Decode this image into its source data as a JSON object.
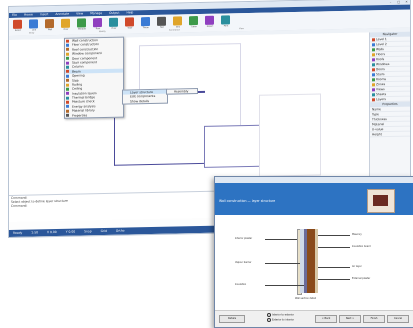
{
  "main_window": {
    "title": "",
    "menu": [
      "File",
      "Home",
      "Insert",
      "Annotate",
      "View",
      "Manage",
      "Output",
      "Help"
    ],
    "ribbon_buttons": [
      {
        "label": "Select",
        "color": "#d04a2b"
      },
      {
        "label": "Line",
        "color": "#3a7bd5"
      },
      {
        "label": "Wall",
        "color": "#b36a2c"
      },
      {
        "label": "Door",
        "color": "#e0a52a"
      },
      {
        "label": "Window",
        "color": "#3d9a4a"
      },
      {
        "label": "Roof",
        "color": "#8f3fbf"
      },
      {
        "label": "Floor",
        "color": "#2a8f9e"
      },
      {
        "label": "Stair",
        "color": "#d04a2b"
      },
      {
        "label": "Room",
        "color": "#3a7bd5"
      },
      {
        "label": "Text",
        "color": "#555555"
      },
      {
        "label": "Dim",
        "color": "#e0a52a"
      },
      {
        "label": "Layer",
        "color": "#3d9a4a"
      },
      {
        "label": "Export",
        "color": "#8f3fbf"
      },
      {
        "label": "Print",
        "color": "#2a8f9e"
      }
    ],
    "ribbon_groups": [
      "Draw",
      "Modify",
      "Annotation",
      "View"
    ],
    "menu_items": [
      {
        "label": "Wall construction",
        "color": "#d04a2b"
      },
      {
        "label": "Floor construction",
        "color": "#3a7bd5"
      },
      {
        "label": "Roof construction",
        "color": "#b36a2c"
      },
      {
        "label": "Window component",
        "color": "#e0a52a"
      },
      {
        "label": "Door component",
        "color": "#3d9a4a"
      },
      {
        "label": "Stair component",
        "color": "#8f3fbf"
      },
      {
        "label": "Column",
        "color": "#2a8f9e"
      },
      {
        "label": "Beam",
        "color": "#d04a2b"
      },
      {
        "label": "Opening",
        "color": "#3a7bd5"
      },
      {
        "label": "Slab",
        "color": "#b36a2c"
      },
      {
        "label": "Railing",
        "color": "#e0a52a"
      },
      {
        "label": "Ceiling",
        "color": "#3d9a4a"
      },
      {
        "label": "Insulation layers",
        "color": "#8f3fbf"
      },
      {
        "label": "Thermal bridge",
        "color": "#2a8f9e"
      },
      {
        "label": "Moisture check",
        "color": "#d04a2b"
      },
      {
        "label": "Energy analysis",
        "color": "#3a7bd5"
      },
      {
        "label": "Material library",
        "color": "#b36a2c"
      },
      {
        "label": "Properties",
        "color": "#555555"
      }
    ],
    "submenu_items": [
      "Layer structure",
      "Edit components",
      "Show details"
    ],
    "submenu2_items": [
      "Assembly"
    ],
    "right_panel": {
      "title": "Navigator",
      "rows": [
        "Level 1",
        "Level 2",
        "Walls",
        "Floors",
        "Roofs",
        "Windows",
        "Doors",
        "Stairs",
        "Rooms",
        "Zones",
        "Views",
        "Sheets",
        "Layers"
      ],
      "lower_title": "Properties",
      "lower_rows": [
        "Name",
        "Type",
        "Thickness",
        "Material",
        "U-value",
        "Height"
      ]
    },
    "log_lines": [
      "Command:",
      "Select object to define layer structure",
      "Command:"
    ],
    "status": [
      "Ready",
      "1:50",
      "X 0.00",
      "Y 0.00",
      "Snap",
      "Grid",
      "Ortho"
    ]
  },
  "dialog": {
    "title": "",
    "heading": "Wall construction — layer structure",
    "callouts_left": [
      "Interior plaster",
      "Vapour barrier",
      "Insulation"
    ],
    "callouts_right": [
      "Masonry",
      "Insulation board",
      "Air layer",
      "External plaster"
    ],
    "caption": "Wall section detail",
    "radio_options": [
      "Interior to exterior",
      "Exterior to interior"
    ],
    "buttons": [
      "Details",
      "< Back",
      "Next >",
      "Finish",
      "Cancel"
    ]
  }
}
